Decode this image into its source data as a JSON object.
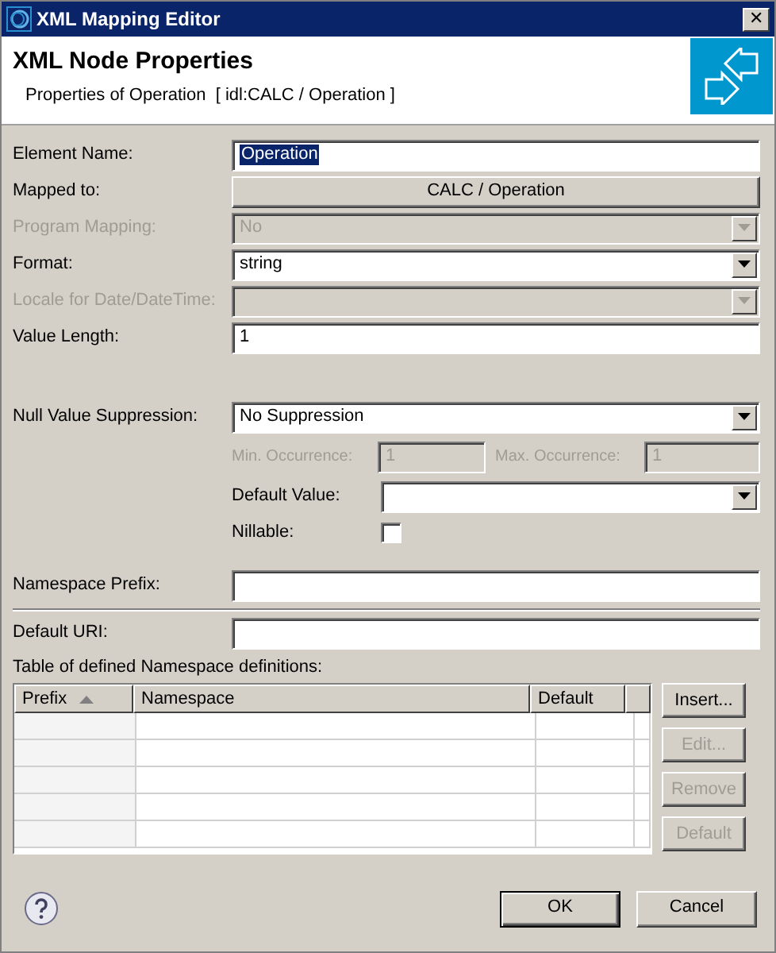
{
  "window": {
    "title": "XML Mapping Editor",
    "close": "✕"
  },
  "header": {
    "title": "XML Node Properties",
    "subtitle": "Properties of Operation  [ idl:CALC / Operation ]"
  },
  "main_fields": [
    {
      "label": "Element Name:",
      "kind": "text",
      "value": "Operation",
      "disabled": false,
      "highlighted": true
    },
    {
      "label": "Mapped to:",
      "kind": "button",
      "value": "CALC / Operation",
      "disabled": false
    },
    {
      "label": "Program Mapping:",
      "kind": "select",
      "value": "No",
      "disabled": true
    },
    {
      "label": "Format:",
      "kind": "select",
      "value": "string",
      "disabled": false
    },
    {
      "label": "Locale for Date/DateTime:",
      "kind": "select",
      "disabled": true
    },
    {
      "label": "Value Length:",
      "kind": "text",
      "value": "1",
      "disabled": false,
      "highlighted": false
    }
  ],
  "null_suppression": {
    "label": "Null Value Suppression:",
    "value": "No Suppression",
    "min_occurrence": {
      "label": "Min. Occurrence:",
      "value": "1",
      "disabled": true
    },
    "max_occurrence": {
      "label": "Max. Occurrence:",
      "value": "1",
      "disabled": true
    },
    "default_value": {
      "label": "Default Value:"
    },
    "nillable": {
      "label": "Nillable:",
      "checked": false
    }
  },
  "namespace_prefix": {
    "label": "Namespace Prefix:"
  },
  "default_uri": {
    "label": "Default URI:"
  },
  "table": {
    "label": "Table of defined Namespace definitions:",
    "columns": [
      {
        "label": "Prefix",
        "sorted": true
      },
      {
        "label": "Namespace",
        "sorted": false
      },
      {
        "label": "Default",
        "sorted": false
      }
    ]
  },
  "table_buttons": [
    {
      "label": "Insert...",
      "disabled": false
    },
    {
      "label": "Edit...",
      "disabled": true
    },
    {
      "label": "Remove",
      "disabled": true
    },
    {
      "label": "Default",
      "disabled": true
    }
  ],
  "footer": {
    "buttons": [
      {
        "label": "OK",
        "default": true
      },
      {
        "label": "Cancel",
        "default": false
      }
    ]
  }
}
